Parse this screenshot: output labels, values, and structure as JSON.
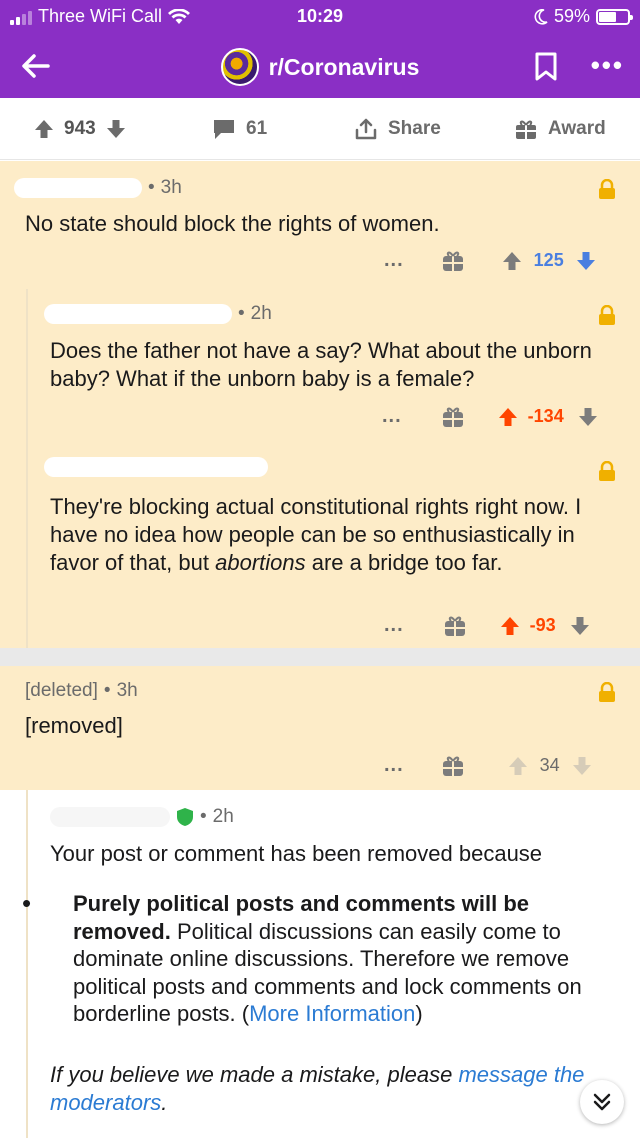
{
  "status": {
    "carrier": "Three WiFi Call",
    "time": "10:29",
    "battery": "59%",
    "battery_level": 0.59
  },
  "header": {
    "title": "r/Coronavirus"
  },
  "post_actions": {
    "votes": "943",
    "comments": "61",
    "share": "Share",
    "award": "Award"
  },
  "comments": [
    {
      "time": "3h",
      "body": "No state should block the rights of women.",
      "more": "...",
      "score": "125"
    },
    {
      "time": "2h",
      "body": "Does the father not have a say? What about the unborn baby? What if the unborn baby is a female?",
      "more": "...",
      "score": "-134"
    },
    {
      "time": "",
      "body_before": "They're blocking actual constitutional rights right now.  I have no idea how people can be so enthusiastically in favor of that, but ",
      "body_emph": "abortions",
      "body_after": " are a bridge too far.",
      "more": "...",
      "score": "-93"
    },
    {
      "author": "[deleted]",
      "time": "3h",
      "body": "[removed]",
      "more": "...",
      "score": "34"
    }
  ],
  "mod_comment": {
    "time": "2h",
    "intro": "Your post or comment has been removed because",
    "rule_bold": "Purely political posts and comments will be removed.",
    "rule_text": " Political discussions can easily come to dominate online discussions. Therefore we remove political posts and comments and lock comments on borderline posts. ",
    "rule_link_open": "(",
    "rule_link": "More Information",
    "rule_link_close": ")",
    "footer_before": "If you believe we made a mistake, please ",
    "footer_link": "message the moderators",
    "footer_after": "."
  },
  "colors": {
    "brand_purple": "#8a2fc5",
    "comment_bg": "#fdecc8",
    "upvote_orange": "#ff4500",
    "downvote_blue": "#4a7fe0",
    "link_blue": "#2b7bd3",
    "mod_green": "#2fb34a"
  },
  "icons": [
    "back-arrow-icon",
    "subreddit-avatar-icon",
    "bookmark-icon",
    "more-icon",
    "upvote-icon",
    "downvote-icon",
    "comment-icon",
    "share-icon",
    "award-icon",
    "lock-icon",
    "gift-icon",
    "shield-icon",
    "double-chevron-down-icon"
  ]
}
